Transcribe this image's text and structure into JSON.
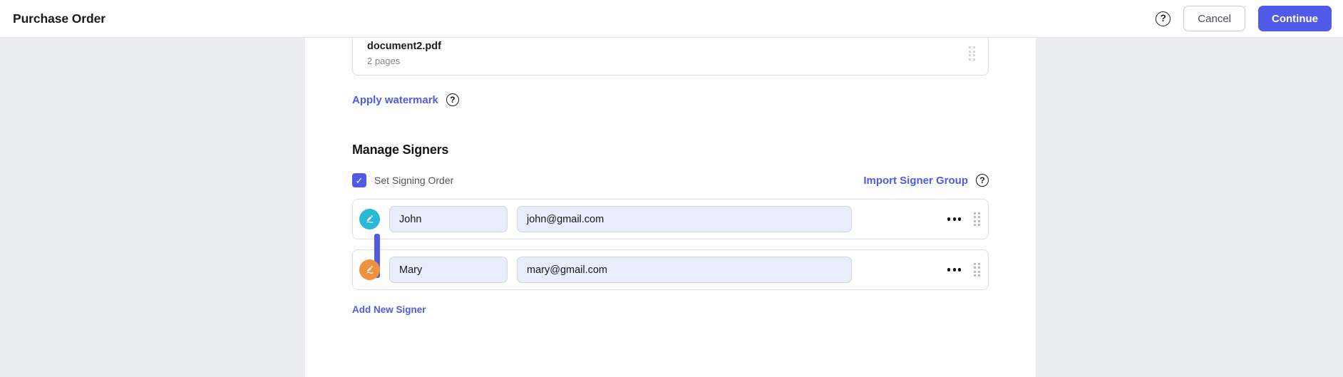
{
  "header": {
    "title": "Purchase Order",
    "help_icon": "question-mark-circle-icon",
    "help_glyph": "?",
    "cancel_label": "Cancel",
    "continue_label": "Continue",
    "accent_color": "#4f5ae8",
    "cancel_border_color": "#c9cad1"
  },
  "document": {
    "name": "document2.pdf",
    "pages": "2 pages",
    "drag_handle_icon": "drag-handle-icon"
  },
  "watermark": {
    "label": "Apply watermark",
    "help_icon": "question-mark-circle-icon",
    "help_glyph": "?"
  },
  "signers_section": {
    "title": "Manage Signers",
    "signing_order": {
      "label": "Set Signing Order",
      "checked": true,
      "check_glyph": "✓",
      "checkbox_color": "#4f5ae8"
    },
    "import_group": {
      "label": "Import Signer Group",
      "help_icon": "question-mark-circle-icon",
      "help_glyph": "?"
    },
    "order_connector_color": "#4f5ae8",
    "rows": [
      {
        "avatar_icon": "signature-pen-icon",
        "avatar_color": "#2ab9d4",
        "name": "John",
        "name_placeholder": "Name",
        "email": "john@gmail.com",
        "email_placeholder": "Email",
        "menu_icon": "ellipsis-icon",
        "drag_handle_icon": "drag-handle-icon"
      },
      {
        "avatar_icon": "signature-pen-icon",
        "avatar_color": "#f0913f",
        "name": "Mary",
        "name_placeholder": "Name",
        "email": "mary@gmail.com",
        "email_placeholder": "Email",
        "menu_icon": "ellipsis-icon",
        "drag_handle_icon": "drag-handle-icon"
      }
    ],
    "add_signer_label": "Add New Signer"
  }
}
